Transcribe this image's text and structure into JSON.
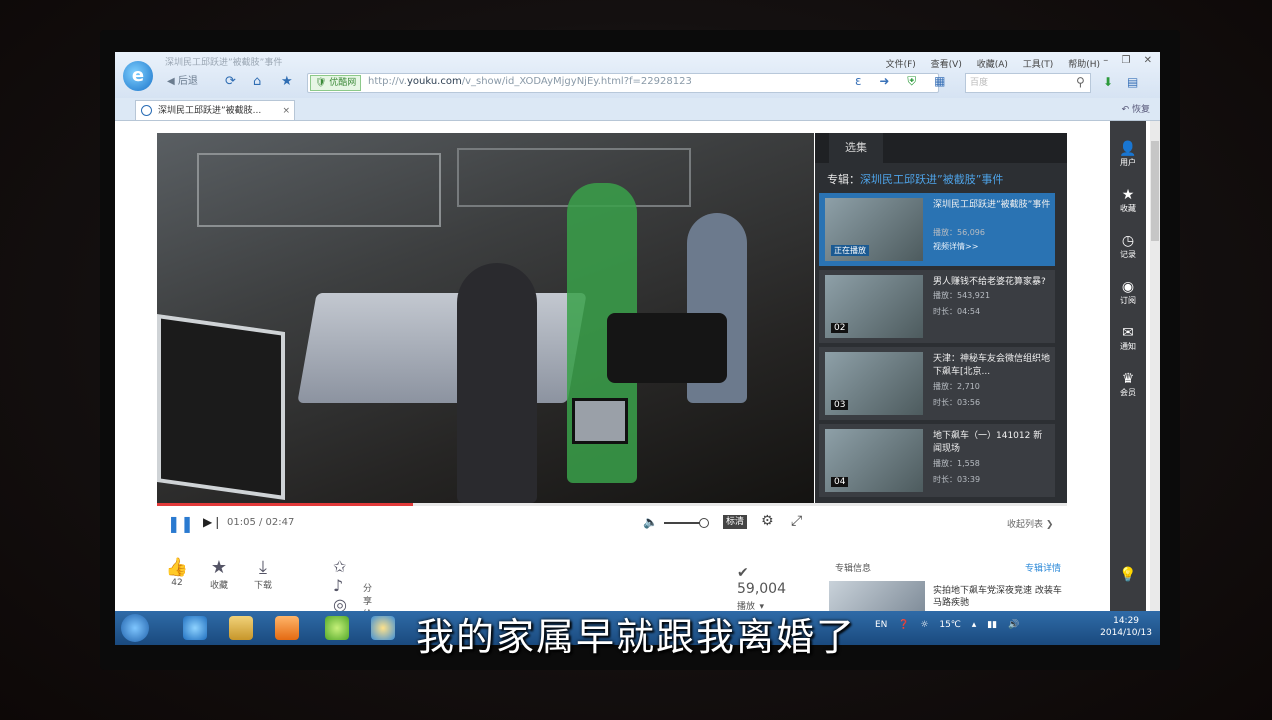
{
  "browser": {
    "window_title": "深圳民工邱跃进”被截肢”事件",
    "menu": [
      "文件(F)",
      "查看(V)",
      "收藏(A)",
      "工具(T)",
      "帮助(H)"
    ],
    "back_label": "后退",
    "secure_label": "优酷网",
    "url_prefix": "http://v.",
    "url_domain": "youku.com",
    "url_path": "/v_show/id_XODAyMjgyNjEy.html?f=22928123",
    "search_placeholder": "百度",
    "tab_title": "深圳民工邱跃进”被截肢...",
    "tab_close": "×",
    "tabbar_right": "恢复"
  },
  "player": {
    "time": "01:05 / 02:47",
    "progress": 0.39,
    "volume": 0.9,
    "quality": "标清",
    "collapse_label": "收起列表"
  },
  "playlist": {
    "tab": "选集",
    "album_prefix": "专辑：",
    "album_name": "深圳民工邱跃进”被截肢”事件",
    "items": [
      {
        "num": "",
        "title": "深圳民工邱跃进”被截肢”事件",
        "plays": "播放：56,096",
        "extra": "视频详情>>",
        "active": true,
        "tag": "正在播放"
      },
      {
        "num": "02",
        "title": "男人赚钱不给老婆花算家暴?",
        "plays": "播放：543,921",
        "extra": "时长：04:54",
        "active": false
      },
      {
        "num": "03",
        "title": "天津：神秘车友会微信组织地下飙车[北京...",
        "plays": "播放：2,710",
        "extra": "时长：03:56",
        "active": false
      },
      {
        "num": "04",
        "title": "地下飙车（一）141012 新闻现场",
        "plays": "播放：1,558",
        "extra": "时长：03:39",
        "active": false
      }
    ]
  },
  "actions": {
    "like_count": "42",
    "fav_label": "收藏",
    "download_label": "下载",
    "share_label": "分享给好友",
    "views": "59,004",
    "views_suffix": "播放"
  },
  "album_info": {
    "title": "专辑信息",
    "link": "专辑详情",
    "item_text": "实拍地下飙车党深夜竞速 改装车马路疾驰"
  },
  "rail": [
    "用户",
    "收藏",
    "记录",
    "订阅",
    "通知",
    "会员"
  ],
  "taskbar": {
    "temp": "15℃",
    "time": "14:29",
    "date": "2014/10/13",
    "lang": "EN"
  },
  "subtitle": "我的家属早就跟我离婚了"
}
